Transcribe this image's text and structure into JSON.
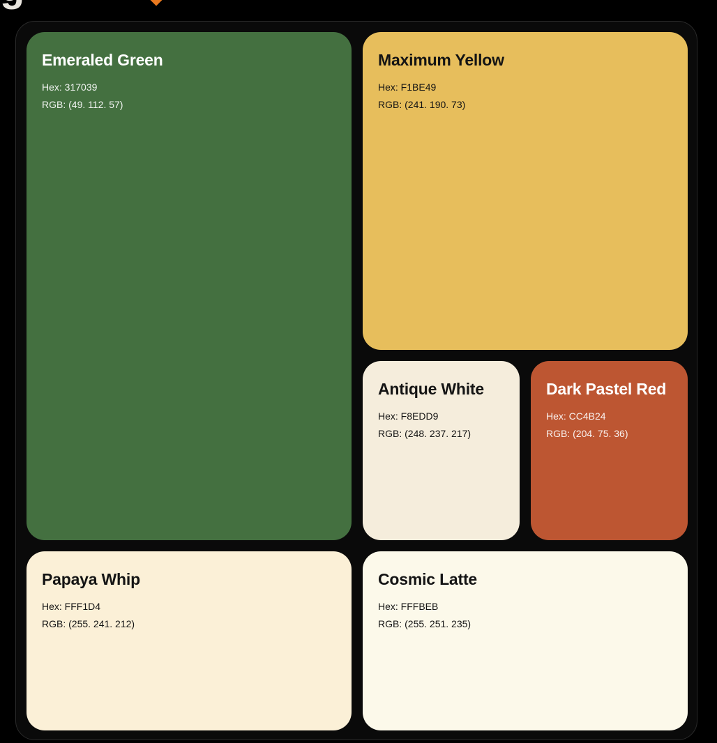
{
  "cards": [
    {
      "name": "Emeraled Green",
      "hex": "Hex: 317039",
      "rgb": "RGB: (49. 112. 57)",
      "background": "#447040"
    },
    {
      "name": "Maximum Yellow",
      "hex": "Hex: F1BE49",
      "rgb": "RGB: (241. 190. 73)",
      "background": "#E7BE5C"
    },
    {
      "name": "Antique White",
      "hex": "Hex: F8EDD9",
      "rgb": "RGB: (248. 237. 217)",
      "background": "#F5EDDC"
    },
    {
      "name": "Dark Pastel Red",
      "hex": "Hex: CC4B24",
      "rgb": "RGB: (204. 75. 36)",
      "background": "#BD5632"
    },
    {
      "name": "Papaya Whip",
      "hex": "Hex: FFF1D4",
      "rgb": "RGB: (255. 241. 212)",
      "background": "#FBF0D7"
    },
    {
      "name": "Cosmic Latte",
      "hex": "Hex: FFFBEB",
      "rgb": "RGB: (255. 251. 235)",
      "background": "#FCF9EA"
    }
  ]
}
